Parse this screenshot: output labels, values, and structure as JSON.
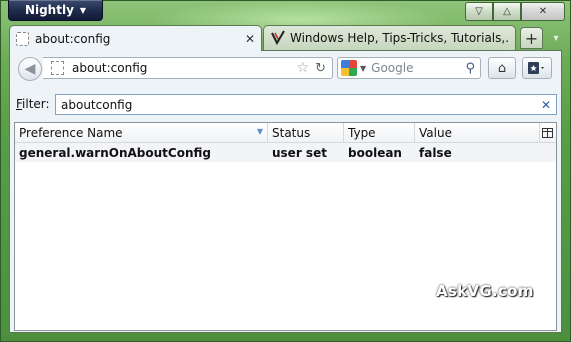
{
  "app_button": {
    "label": "Nightly"
  },
  "caption": {
    "minimize": "▽",
    "maximize": "△",
    "close": "✕"
  },
  "tabs": [
    {
      "label": "about:config",
      "close": "✕"
    },
    {
      "label": "Windows Help, Tips-Tricks, Tutorials,..."
    }
  ],
  "new_tab_label": "+",
  "tab_list_label": "▾",
  "navbar": {
    "back": "◀",
    "url": "about:config",
    "search_placeholder": "Google",
    "search_drop": "▼",
    "home": "⌂"
  },
  "filter": {
    "label_mnemonic": "F",
    "label_rest": "ilter:",
    "value": "aboutconfig"
  },
  "table": {
    "columns": [
      "Preference Name",
      "Status",
      "Type",
      "Value"
    ],
    "rows": [
      {
        "name": "general.warnOnAboutConfig",
        "status": "user set",
        "type": "boolean",
        "value": "false"
      }
    ]
  },
  "watermark": "AskVG.com",
  "colors": {
    "frame": "#5a9c47",
    "content_bg": "#eef3f8",
    "app_button": "#1d2a4a"
  }
}
